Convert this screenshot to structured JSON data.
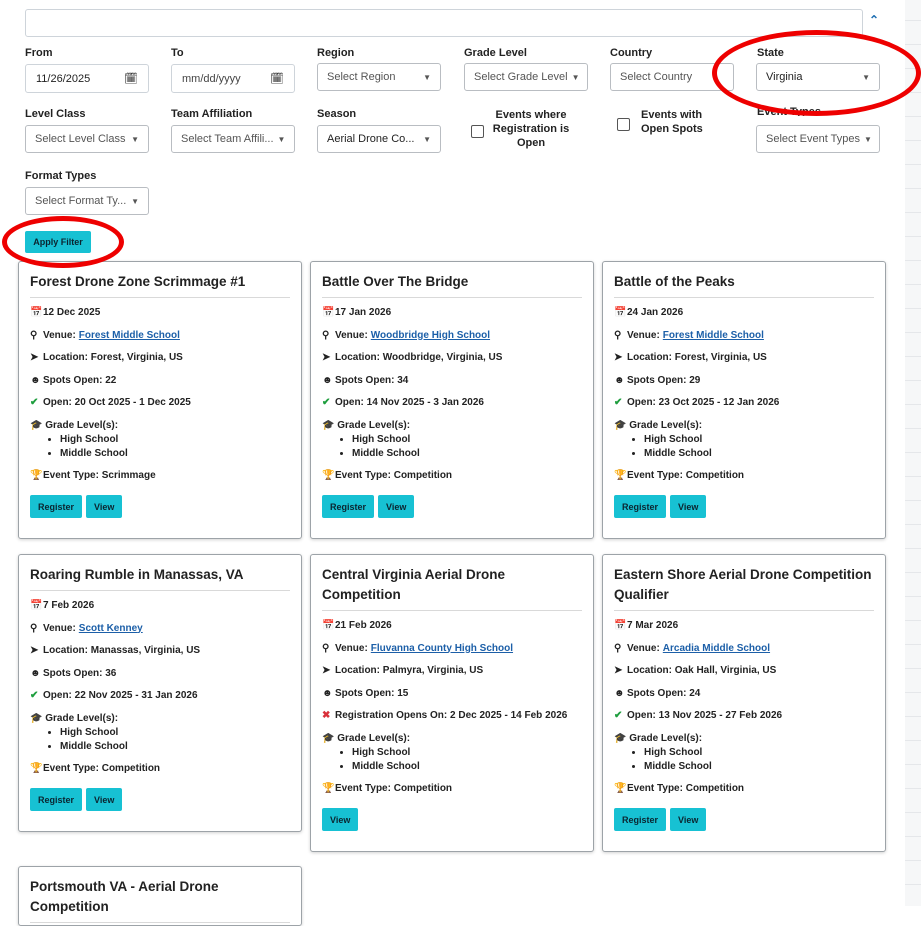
{
  "filters": {
    "from": {
      "label": "From",
      "value": "11/26/2025"
    },
    "to": {
      "label": "To",
      "placeholder": "mm/dd/yyyy"
    },
    "region": {
      "label": "Region",
      "value": "Select Region"
    },
    "grade_level": {
      "label": "Grade Level",
      "value": "Select Grade Level"
    },
    "country": {
      "label": "Country",
      "value": "Select Country"
    },
    "state": {
      "label": "State",
      "value": "Virginia"
    },
    "level_class": {
      "label": "Level Class",
      "value": "Select Level Class"
    },
    "team_affiliation": {
      "label": "Team Affiliation",
      "value": "Select Team Affili..."
    },
    "season": {
      "label": "Season",
      "value": "Aerial Drone Co..."
    },
    "events_open": {
      "label": "Events where Registration is Open"
    },
    "events_spots": {
      "label": "Events with Open Spots"
    },
    "event_types": {
      "label": "Event Types",
      "value": "Select Event Types"
    },
    "format_types": {
      "label": "Format Types",
      "value": "Select Format Ty..."
    },
    "apply_label": "Apply Filter"
  },
  "labels": {
    "venue": "Venue:",
    "location": "Location:",
    "spots": "Spots Open:",
    "open": "Open:",
    "reg_opens": "Registration Opens On:",
    "grade": "Grade Level(s):",
    "event_type": "Event Type:",
    "register": "Register",
    "view": "View"
  },
  "events": [
    {
      "title": "Forest Drone Zone Scrimmage #1",
      "date": "12 Dec 2025",
      "venue": "Forest Middle School",
      "location": "Forest, Virginia, US",
      "spots": "22",
      "open": "20 Oct 2025 - 1 Dec 2025",
      "grades": [
        "High School",
        "Middle School"
      ],
      "event_type": "Scrimmage"
    },
    {
      "title": "Battle Over The Bridge",
      "date": "17 Jan 2026",
      "venue": "Woodbridge High School",
      "location": "Woodbridge, Virginia, US",
      "spots": "34",
      "open": "14 Nov 2025 - 3 Jan 2026",
      "grades": [
        "High School",
        "Middle School"
      ],
      "event_type": "Competition"
    },
    {
      "title": "Battle of the Peaks",
      "date": "24 Jan 2026",
      "venue": "Forest Middle School",
      "location": "Forest, Virginia, US",
      "spots": "29",
      "open": "23 Oct 2025 - 12 Jan 2026",
      "grades": [
        "High School",
        "Middle School"
      ],
      "event_type": "Competition"
    },
    {
      "title": "Roaring Rumble in Manassas, VA",
      "date": "7 Feb 2026",
      "venue": "Scott Kenney",
      "location": "Manassas, Virginia, US",
      "spots": "36",
      "open": "22 Nov 2025 - 31 Jan 2026",
      "grades": [
        "High School",
        "Middle School"
      ],
      "event_type": "Competition"
    },
    {
      "title": "Central Virginia Aerial Drone Competition",
      "date": "21 Feb 2026",
      "venue": "Fluvanna County High School",
      "location": "Palmyra, Virginia, US",
      "spots": "15",
      "reg_opens": "2 Dec 2025 - 14 Feb 2026",
      "grades": [
        "High School",
        "Middle School"
      ],
      "event_type": "Competition"
    },
    {
      "title": "Eastern Shore Aerial Drone Competition Qualifier",
      "date": "7 Mar 2026",
      "venue": "Arcadia Middle School",
      "location": "Oak Hall, Virginia, US",
      "spots": "24",
      "open": "13 Nov 2025 - 27 Feb 2026",
      "grades": [
        "High School",
        "Middle School"
      ],
      "event_type": "Competition"
    },
    {
      "title": "Portsmouth VA - Aerial Drone Competition"
    }
  ]
}
